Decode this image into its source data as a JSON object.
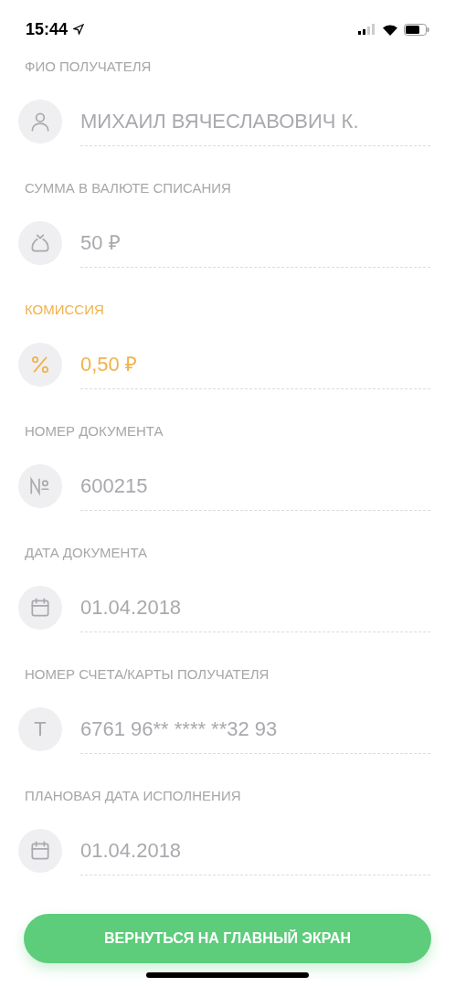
{
  "status_bar": {
    "time": "15:44"
  },
  "fields": [
    {
      "label": "ФИО ПОЛУЧАТЕЛЯ",
      "kind": "person",
      "value": "МИХАИЛ ВЯЧЕСЛАВОВИЧ К.",
      "highlighted": false
    },
    {
      "label": "СУММА В ВАЛЮТЕ СПИСАНИЯ",
      "kind": "bag",
      "value": "50 ₽",
      "highlighted": false
    },
    {
      "label": "КОМИССИЯ",
      "kind": "percent",
      "value": "0,50 ₽",
      "highlighted": true
    },
    {
      "label": "НОМЕР ДОКУМЕНТА",
      "kind": "number",
      "value": "600215",
      "highlighted": false
    },
    {
      "label": "ДАТА ДОКУМЕНТА",
      "kind": "calendar",
      "value": "01.04.2018",
      "highlighted": false
    },
    {
      "label": "НОМЕР СЧЕТА/КАРТЫ ПОЛУЧАТЕЛЯ",
      "kind": "letter",
      "icon_text": "T",
      "value": "6761 96** **** **32 93",
      "highlighted": false
    },
    {
      "label": "ПЛАНОВАЯ ДАТА ИСПОЛНЕНИЯ",
      "kind": "calendar",
      "value": "01.04.2018",
      "highlighted": false
    }
  ],
  "button": "ВЕРНУТЬСЯ НА ГЛАВНЫЙ ЭКРАН"
}
